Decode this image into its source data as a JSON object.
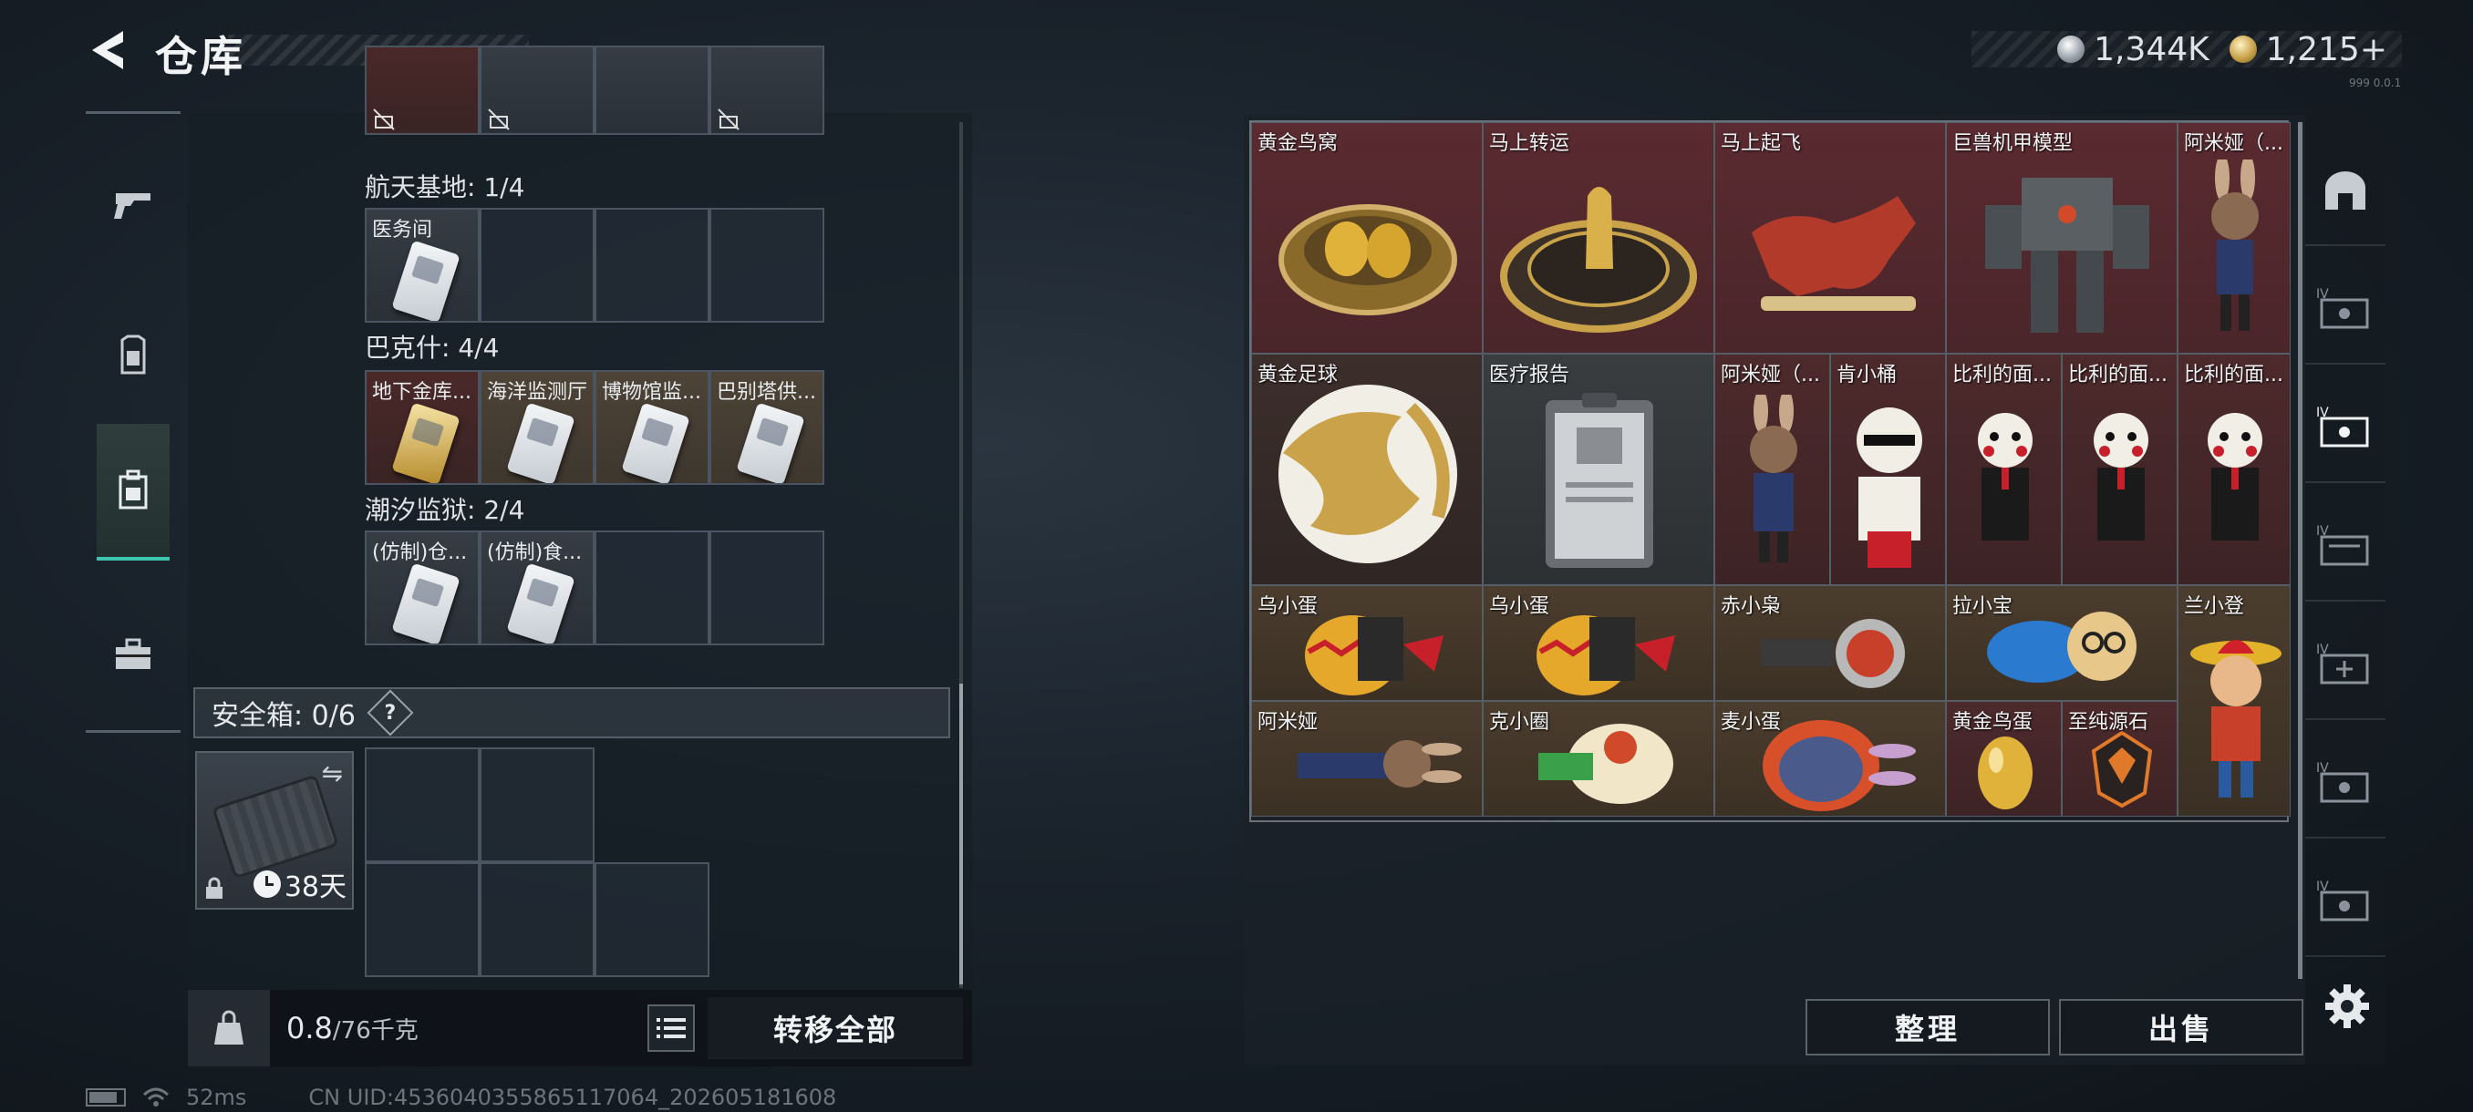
{
  "header": {
    "title": "仓库",
    "currencies": [
      {
        "name": "silver-coin",
        "value": "1,344K",
        "color": "#b8c0c8"
      },
      {
        "name": "gold-coin",
        "value": "1,215+",
        "color": "#c9a24a"
      }
    ],
    "build_text": "999 0.0.1"
  },
  "left_sidebar": {
    "items": [
      {
        "icon": "gun-icon"
      },
      {
        "icon": "armor-icon"
      },
      {
        "icon": "backpack-icon",
        "active": true
      },
      {
        "icon": "toolbox-icon"
      }
    ]
  },
  "left_panel": {
    "sections": [
      {
        "label": "航天基地: 1/4",
        "cells": [
          "医务间",
          "",
          "",
          ""
        ]
      },
      {
        "label": "巴克什: 4/4",
        "cells": [
          "地下金库...",
          "海洋监测厅",
          "博物馆监...",
          "巴别塔供..."
        ]
      },
      {
        "label": "潮汐监狱: 2/4",
        "cells": [
          "(仿制)仓...",
          "(仿制)食...",
          "",
          ""
        ]
      }
    ],
    "safebox": {
      "label": "安全箱: 0/6",
      "help": "?",
      "timer": "38天"
    },
    "weight": {
      "current": "0.8",
      "max": "/76千克"
    },
    "transfer_all": "转移全部"
  },
  "status_bar": {
    "ping": "52ms",
    "uid": "CN UID:4536040355865117064_202605181608"
  },
  "storage_items": [
    {
      "name": "黄金鸟窝"
    },
    {
      "name": "马上转运"
    },
    {
      "name": "马上起飞"
    },
    {
      "name": "巨兽机甲模型"
    },
    {
      "name": "阿米娅（..."
    },
    {
      "name": "黄金足球"
    },
    {
      "name": "医疗报告"
    },
    {
      "name": "阿米娅（..."
    },
    {
      "name": "肯小桶"
    },
    {
      "name": "比利的面..."
    },
    {
      "name": "比利的面..."
    },
    {
      "name": "比利的面..."
    },
    {
      "name": "乌小蛋"
    },
    {
      "name": "乌小蛋"
    },
    {
      "name": "赤小枭"
    },
    {
      "name": "拉小宝"
    },
    {
      "name": "兰小登"
    },
    {
      "name": "阿米娅"
    },
    {
      "name": "克小圈"
    },
    {
      "name": "麦小蛋"
    },
    {
      "name": "黄金鸟蛋"
    },
    {
      "name": "至纯源石"
    }
  ],
  "right_actions": {
    "sort": "整理",
    "sell": "出售"
  },
  "right_rail": {
    "items": [
      {
        "icon": "arch-icon",
        "label": ""
      },
      {
        "icon": "ticket-icon",
        "label": "IV"
      },
      {
        "icon": "ticket-active-icon",
        "label": "IV"
      },
      {
        "icon": "ticket-stack-icon",
        "label": "IV"
      },
      {
        "icon": "ticket-plus-icon",
        "label": "IV"
      },
      {
        "icon": "ticket-icon",
        "label": "IV"
      },
      {
        "icon": "ticket-icon",
        "label": "IV"
      }
    ]
  }
}
